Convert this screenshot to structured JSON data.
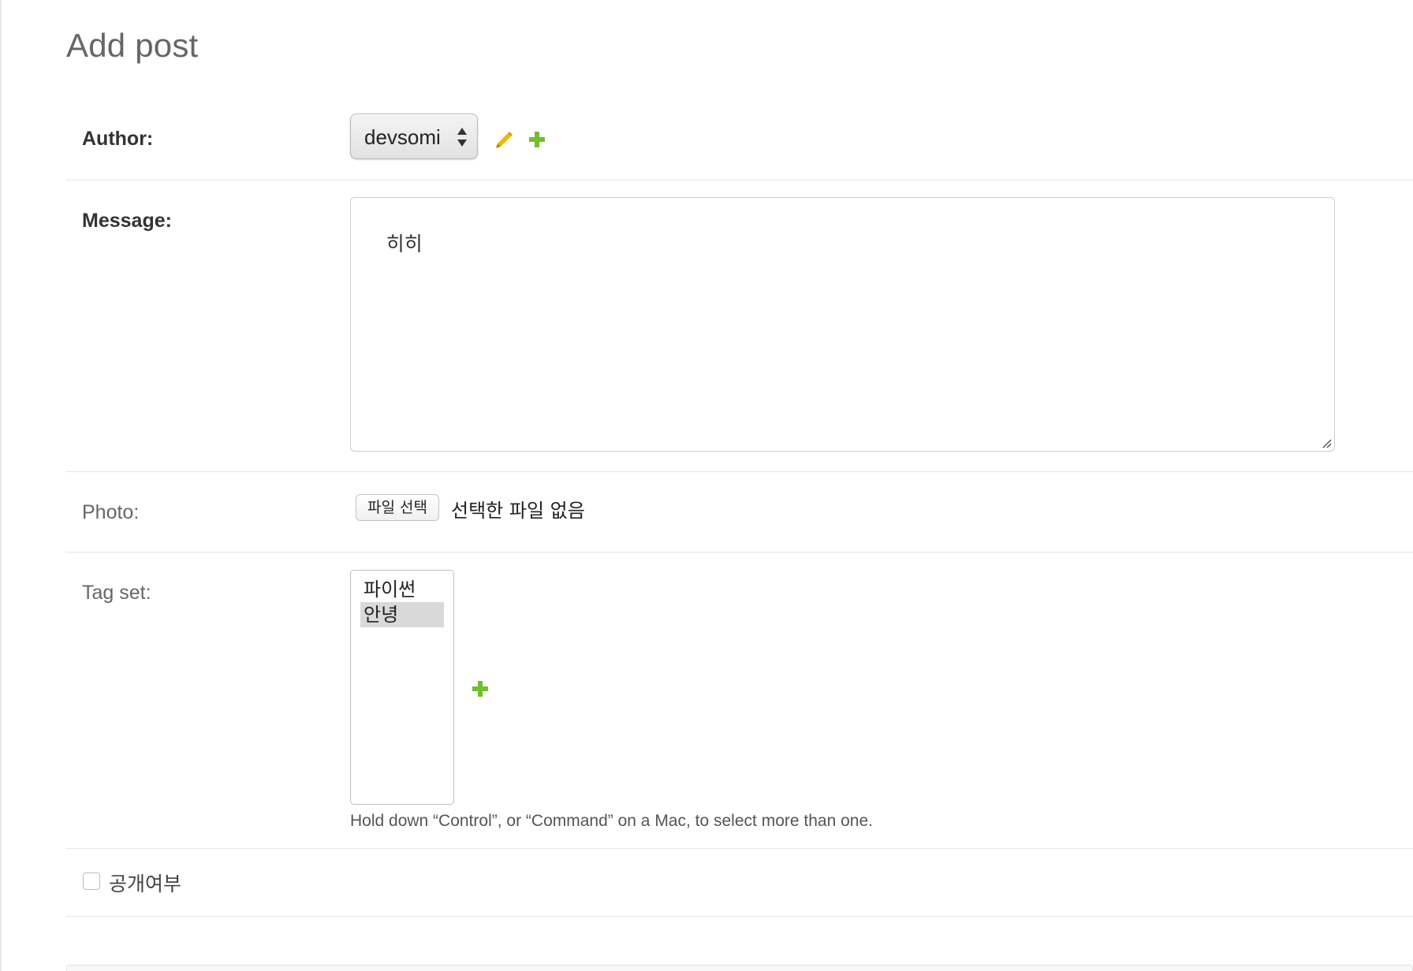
{
  "page": {
    "title": "Add post"
  },
  "author": {
    "label": "Author:",
    "selected": "devsomi",
    "edit_icon": "pencil-icon",
    "add_icon": "plus-icon",
    "edit_color": "#efb80b",
    "add_color": "#70bf2b"
  },
  "message": {
    "label": "Message:",
    "value": "히히"
  },
  "photo": {
    "label": "Photo:",
    "button_label": "파일 선택",
    "status": "선택한 파일 없음"
  },
  "tag_set": {
    "label": "Tag set:",
    "options": [
      {
        "label": "파이썬",
        "selected": false
      },
      {
        "label": "안녕",
        "selected": true
      }
    ],
    "add_icon": "plus-icon",
    "help_text": "Hold down “Control”, or “Command” on a Mac, to select more than one."
  },
  "is_public": {
    "label": "공개여부",
    "checked": false
  }
}
